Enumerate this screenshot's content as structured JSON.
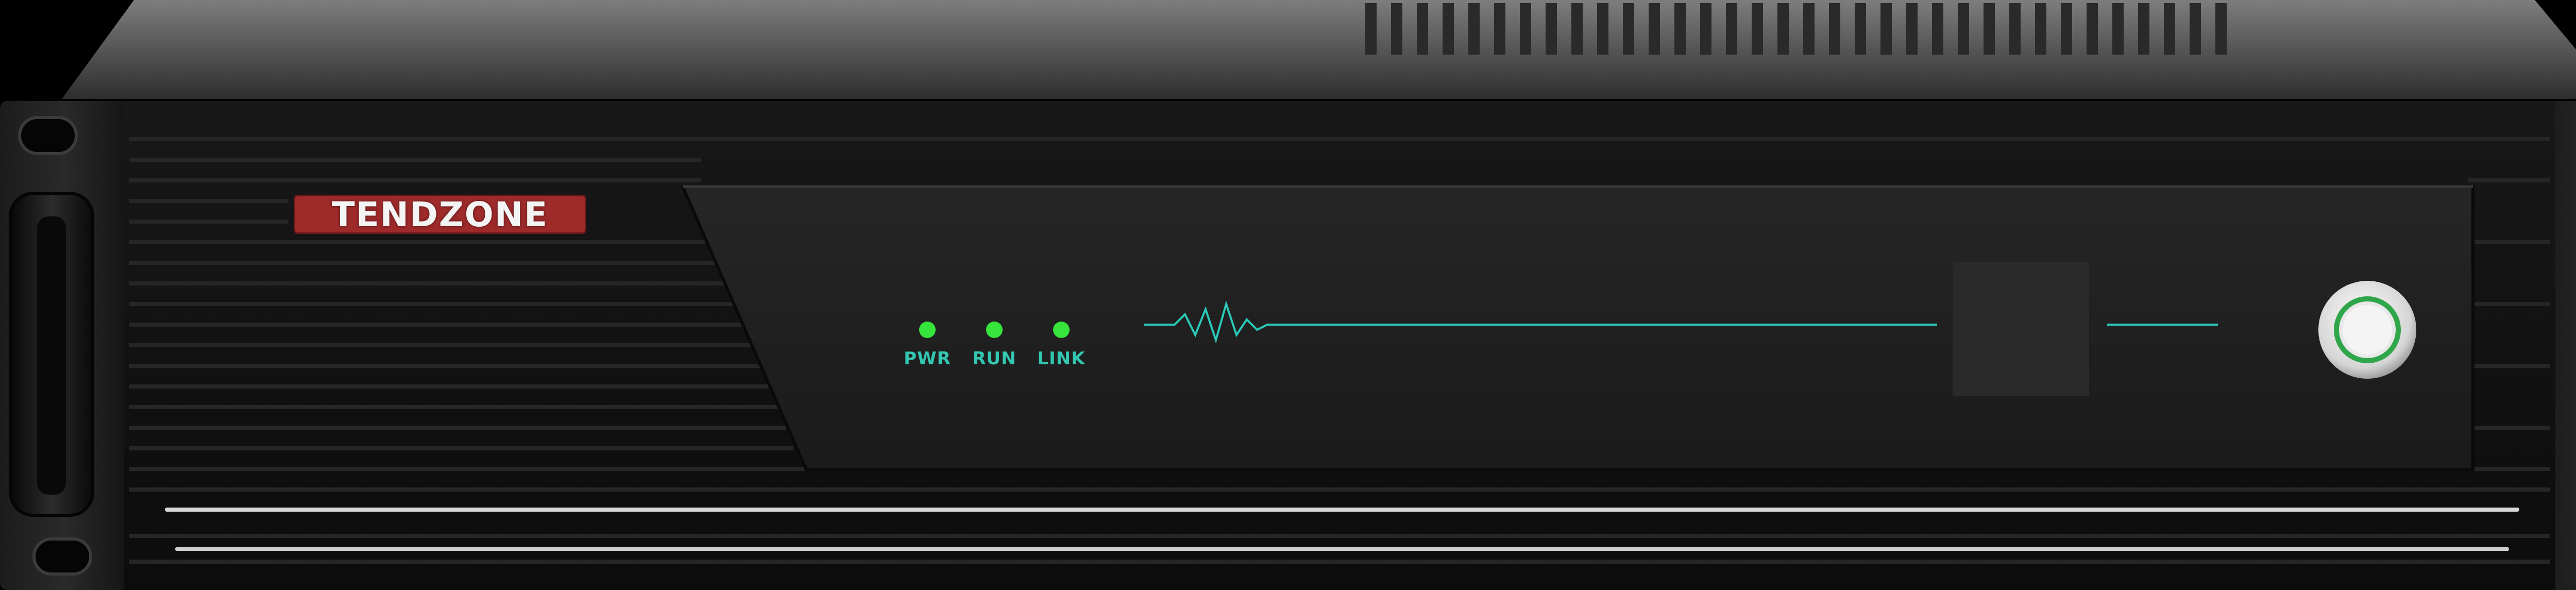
{
  "device": {
    "brand": "TENDZONE",
    "indicators": [
      {
        "label": "PWR",
        "color": "#36e43c"
      },
      {
        "label": "RUN",
        "color": "#36e43c"
      },
      {
        "label": "LINK",
        "color": "#36e43c"
      }
    ],
    "colors": {
      "chassis": "#121212",
      "faceplate": "#1f1f1f",
      "accent_line": "#2bc9b8",
      "brand_bg": "#9e2a2a",
      "power_ring": "#2fa64a"
    }
  }
}
